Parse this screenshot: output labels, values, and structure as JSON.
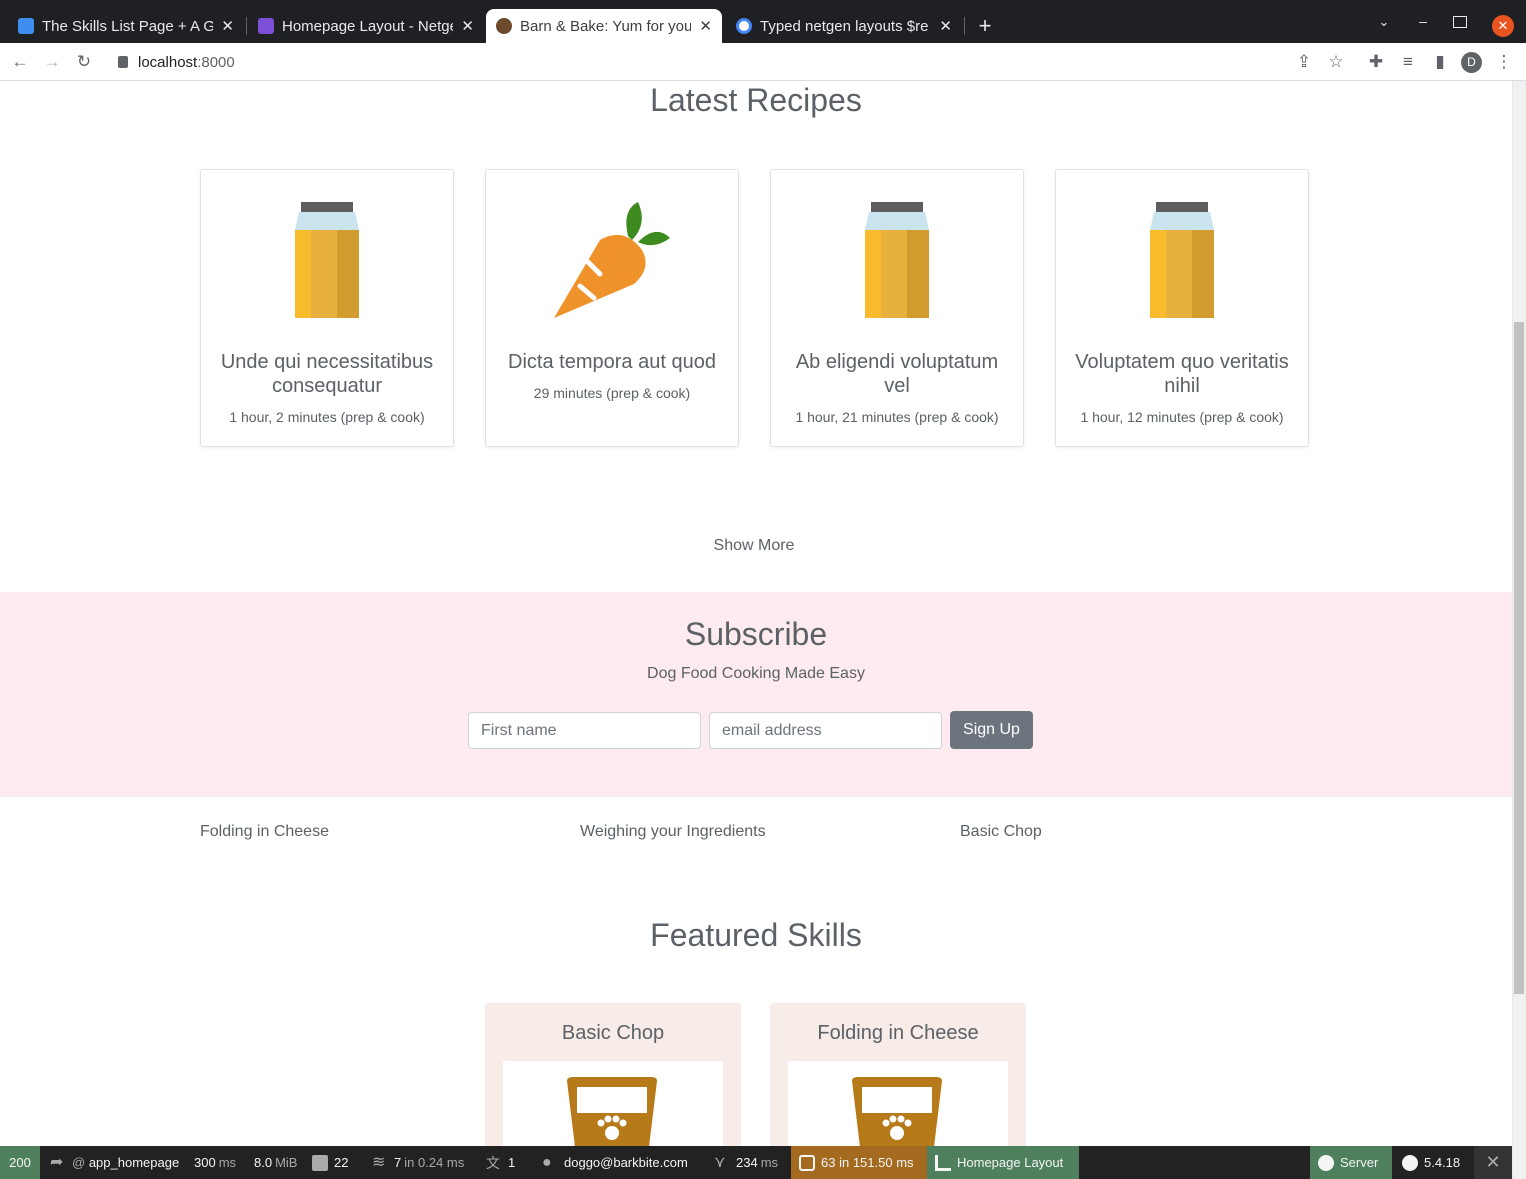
{
  "browser": {
    "tabs": [
      {
        "title": "The Skills List Page + A Gri",
        "favicon": "sf-casts-icon",
        "color": "#3d8ef0"
      },
      {
        "title": "Homepage Layout - Netge",
        "favicon": "netgen-layouts-icon",
        "color": "#7b4fd6"
      },
      {
        "title": "Barn & Bake: Yum for your",
        "favicon": "bowl-icon",
        "color": "#6b4a2e"
      },
      {
        "title": "Typed netgen layouts $re",
        "favicon": "google-icon",
        "color": "#4285f4"
      }
    ],
    "active_tab": 2,
    "url_host": "localhost",
    "url_port": ":8000",
    "profile_initial": "D"
  },
  "recipes": {
    "heading": "Latest Recipes",
    "items": [
      {
        "title": "Unde qui necessitatibus consequatur",
        "time": "1 hour, 2 minutes (prep & cook)",
        "icon": "jar-icon"
      },
      {
        "title": "Dicta tempora aut quod",
        "time": "29 minutes (prep & cook)",
        "icon": "carrot-icon"
      },
      {
        "title": "Ab eligendi voluptatum vel",
        "time": "1 hour, 21 minutes (prep & cook)",
        "icon": "jar-icon"
      },
      {
        "title": "Voluptatem quo veritatis nihil",
        "time": "1 hour, 12 minutes (prep & cook)",
        "icon": "jar-icon"
      }
    ],
    "show_more": "Show More"
  },
  "subscribe": {
    "heading": "Subscribe",
    "subheading": "Dog Food Cooking Made Easy",
    "first_name_placeholder": "First name",
    "email_placeholder": "email address",
    "button": "Sign Up"
  },
  "skill_links": [
    "Folding in Cheese",
    "Weighing your Ingredients",
    "Basic Chop"
  ],
  "featured": {
    "heading": "Featured Skills",
    "items": [
      {
        "title": "Basic Chop"
      },
      {
        "title": "Folding in Cheese"
      }
    ]
  },
  "debug_toolbar": {
    "status": "200",
    "route": "app_homepage",
    "time": "300",
    "time_unit": "ms",
    "memory": "8.0",
    "memory_unit": "MiB",
    "logs": "22",
    "cache": "7",
    "cache_detail": "in 0.24 ms",
    "translations": "1",
    "user": "doggo@barkbite.com",
    "twig": "234",
    "twig_unit": "ms",
    "db": "63",
    "db_detail": "in 151.50 ms",
    "layout": "Homepage Layout",
    "server": "Server",
    "version": "5.4.18",
    "colors": {
      "status": "#4f805d",
      "db": "#a46a1f",
      "layout": "#4f805d"
    }
  }
}
